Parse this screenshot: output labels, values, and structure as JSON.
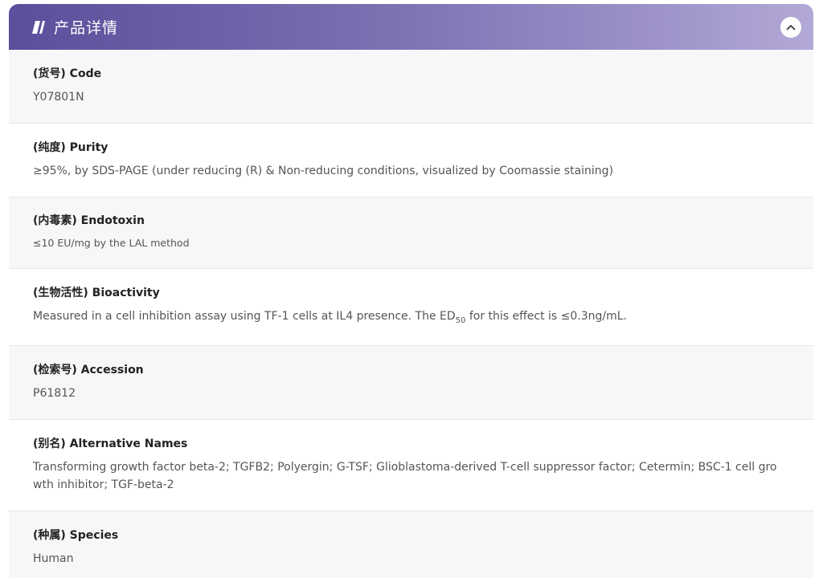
{
  "header": {
    "title": "产品详情",
    "icon": "double-slash-icon",
    "collapse_icon": "chevron-up-icon",
    "accent_color": "#5a4f9c"
  },
  "rows": [
    {
      "label": "(货号) Code",
      "value": "Y07801N"
    },
    {
      "label": "(纯度) Purity",
      "value": "≥95%, by SDS-PAGE (under reducing (R) & Non-reducing conditions, visualized by Coomassie staining)"
    },
    {
      "label": "(内毒素) Endotoxin",
      "value": "≤10 EU/mg by the LAL method"
    },
    {
      "label": "(生物活性) Bioactivity",
      "value_pre": "Measured in a cell inhibition assay using TF-1 cells at IL4 presence. The ED",
      "value_sub": "50",
      "value_post": " for this effect is ≤0.3ng/mL."
    },
    {
      "label": "(检索号) Accession",
      "value": "P61812"
    },
    {
      "label": "(别名) Alternative Names",
      "value_line1": "Transforming growth factor beta-2; TGFB2; Polyergin; G-TSF; Glioblastoma-derived T-cell suppressor factor; Cetermin; BSC-1 cell gro",
      "value_line2": "wth inhibitor; TGF-beta-2"
    },
    {
      "label": "(种属) Species",
      "value": "Human"
    }
  ]
}
